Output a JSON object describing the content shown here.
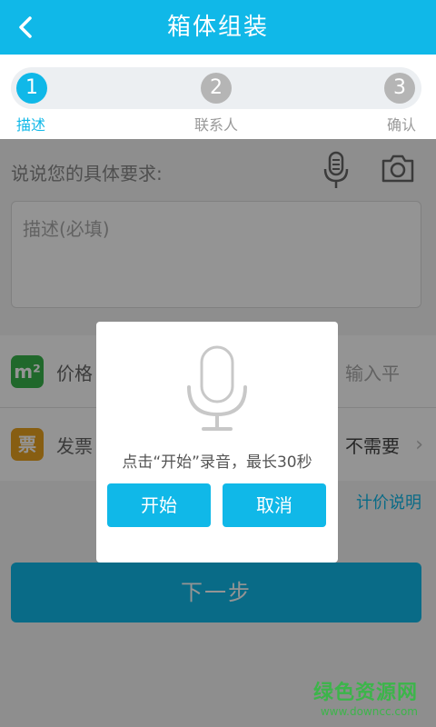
{
  "header": {
    "title": "箱体组装"
  },
  "stepper": {
    "steps": [
      {
        "number": "1",
        "label": "描述"
      },
      {
        "number": "2",
        "label": "联系人"
      },
      {
        "number": "3",
        "label": "确认"
      }
    ]
  },
  "requirement": {
    "label": "说说您的具体要求:",
    "placeholder": "描述(必填)"
  },
  "rows": [
    {
      "badge": "m²",
      "label": "价格",
      "hint": "输入平"
    },
    {
      "badge": "票",
      "label": "发票",
      "value": "不需要"
    }
  ],
  "price_link": "计价说明",
  "next_button": "下一步",
  "dialog": {
    "message": "点击“开始”录音，最长30秒",
    "start_label": "开始",
    "cancel_label": "取消"
  },
  "watermark": {
    "main": "绿色资源网",
    "sub": "www.downcc.com"
  },
  "colors": {
    "accent": "#10b8e8",
    "green": "#37b34a",
    "gold": "#e9a21f"
  }
}
